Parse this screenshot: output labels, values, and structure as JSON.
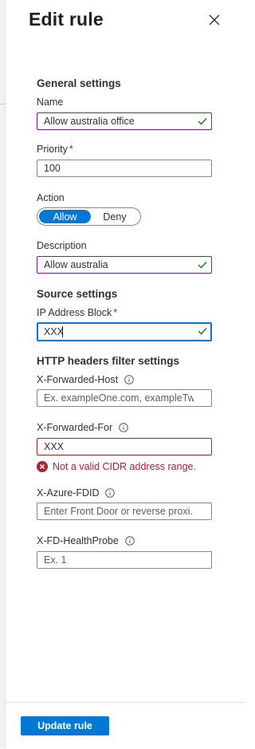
{
  "panel": {
    "title": "Edit rule",
    "close_icon": "close-icon"
  },
  "general": {
    "heading": "General settings",
    "name": {
      "label": "Name",
      "value": "Allow australia office"
    },
    "priority": {
      "label": "Priority",
      "required_mark": "*",
      "value": "100"
    },
    "action": {
      "label": "Action",
      "options": [
        "Allow",
        "Deny"
      ],
      "selected": "Allow"
    },
    "description": {
      "label": "Description",
      "value": "Allow australia"
    }
  },
  "source": {
    "heading": "Source settings",
    "ip_block": {
      "label": "IP Address Block",
      "required_mark": "*",
      "value": "XXX"
    }
  },
  "http_headers": {
    "heading": "HTTP headers filter settings",
    "forwarded_host": {
      "label": "X-Forwarded-Host",
      "placeholder": "Ex. exampleOne.com, exampleTw..."
    },
    "forwarded_for": {
      "label": "X-Forwarded-For",
      "value": "XXX",
      "error": "Not a valid CIDR address range."
    },
    "azure_fdid": {
      "label": "X-Azure-FDID",
      "placeholder": "Enter Front Door or reverse proxi..."
    },
    "health_probe": {
      "label": "X-FD-HealthProbe",
      "placeholder": "Ex. 1"
    }
  },
  "footer": {
    "submit_label": "Update rule"
  },
  "colors": {
    "accent": "#0078d4",
    "valid_border": "#881798",
    "valid_check": "#107c10",
    "error": "#a4262c",
    "required": "#a4262c"
  }
}
